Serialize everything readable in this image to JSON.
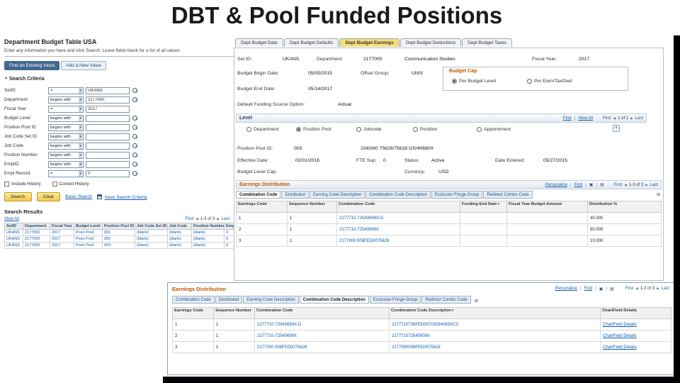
{
  "slide": {
    "title": "DBT & Pool Funded Positions"
  },
  "icons": {
    "dropdown": "▾",
    "collapse": "▼",
    "prev": "◀",
    "next": "▶",
    "sort_desc": "▼",
    "popup": "▣",
    "grid": "▤",
    "show_all": "⊞",
    "plus": "+",
    "sep": "|"
  },
  "colors": {
    "link_blue": "#0b5cab",
    "section_orange": "#c05600",
    "active_tab_yellow": "#f5dd7e",
    "tab_navy": "#44688f"
  },
  "search": {
    "page_title": "Department Budget Table USA",
    "instructions": "Enter any information you have and click Search. Leave fields blank for a list of all values.",
    "tabs": {
      "find": "Find an Existing Value",
      "add": "Add a New Value"
    },
    "criteria_title": "Search Criteria",
    "fields": [
      {
        "label": "SetID",
        "op": "=",
        "value": "UKANS"
      },
      {
        "label": "Department",
        "op": "begins with",
        "value": "2177000"
      },
      {
        "label": "Fiscal Year",
        "op": "=",
        "value": "2017"
      },
      {
        "label": "Budget Level",
        "op": "begins with",
        "value": ""
      },
      {
        "label": "Position Pool ID",
        "op": "begins with",
        "value": ""
      },
      {
        "label": "Job Code Set ID",
        "op": "begins with",
        "value": ""
      },
      {
        "label": "Job Code",
        "op": "begins with",
        "value": ""
      },
      {
        "label": "Position Number",
        "op": "begins with",
        "value": ""
      },
      {
        "label": "EmplID",
        "op": "begins with",
        "value": ""
      },
      {
        "label": "Empl Record",
        "op": "=",
        "value": "0"
      }
    ],
    "include_history": "Include History",
    "correct_history": "Correct History",
    "buttons": {
      "search": "Search",
      "clear": "Clear",
      "basic_search": "Basic Search",
      "save_criteria": "Save Search Criteria"
    },
    "results": {
      "title": "Search Results",
      "view_all": "View All",
      "pager": {
        "first": "First",
        "range": "1-3 of 3",
        "last": "Last"
      },
      "columns": [
        "SetID",
        "Department",
        "Fiscal Year",
        "Budget Level",
        "Position Pool ID",
        "Job Code Set ID",
        "Job Code",
        "Position Number",
        "Empl ID"
      ],
      "rows": [
        [
          "UKANS",
          "2177000",
          "2017",
          "Posn Pool",
          "001",
          "(blank)",
          "(blank)",
          "(blank)",
          "0"
        ],
        [
          "UKANS",
          "2177000",
          "2017",
          "Posn Pool",
          "002",
          "(blank)",
          "(blank)",
          "(blank)",
          "0"
        ],
        [
          "UKANS",
          "2177000",
          "2017",
          "Posn Pool",
          "003",
          "(blank)",
          "(blank)",
          "(blank)",
          "0"
        ]
      ]
    }
  },
  "budget": {
    "tabs": [
      "Dept Budget Data",
      "Dept Budget Defaults",
      "Dept Budget Earnings",
      "Dept Budget Deductions",
      "Dept Budget Taxes"
    ],
    "header": {
      "setid_label": "Set ID:",
      "setid": "UKANS",
      "dept_label": "Department:",
      "dept": "2177000",
      "dept_desc": "Communication Studies",
      "fy_label": "Fiscal Year:",
      "fy": "2017",
      "begin_label": "Budget Begin Date:",
      "begin": "05/05/2015",
      "offset_label": "Offset Group:",
      "offset": "UNIV",
      "end_label": "Budget End Date:",
      "end": "05/14/2017",
      "funding_label": "Default Funding Source Option:",
      "funding": "Actual"
    },
    "budget_cap": {
      "title": "Budget Cap",
      "opt_level": "Per Budget Level",
      "opt_earn": "Per Earn/Tax/Ded"
    },
    "level": {
      "title": "Level",
      "find": "Find",
      "view_all": "View All",
      "pager": {
        "first": "First",
        "range": "1 of 1",
        "last": "Last"
      },
      "options": [
        "Department",
        "Position Pool",
        "Jobcode",
        "Position",
        "Appointment"
      ],
      "pool_label": "Position Pool ID:",
      "pool_value": "003",
      "pool_desc": "1040/60 75628/75628 GS/40680X",
      "eff_label": "Effective Date:",
      "eff_date": "02/01/2016",
      "fte_label": "FTE Sup:",
      "fte": "0",
      "status_label": "Status:",
      "status": "Active",
      "entered_label": "Date Entered:",
      "entered": "05/27/2015",
      "cap_label": "Budget Level Cap:",
      "currency_label": "Currency:",
      "currency": "USD"
    },
    "earnings": {
      "title": "Earnings Distribution",
      "personalize": "Personalize",
      "find": "Find",
      "pager": {
        "first": "First",
        "range": "1-3 of 3",
        "last": "Last"
      },
      "tabs": [
        "Combination Code",
        "Distributed",
        "Earning Code Description",
        "Combination Code Description",
        "Exclusion Fringe Group",
        "Redirect Combo Code"
      ],
      "columns": [
        "Earnings Code",
        "Sequence Number",
        "Combination Code",
        "Funding End Date",
        "Fiscal Year Budget Amount",
        "Distribution %"
      ],
      "rows": [
        [
          "1",
          "1",
          "2177710-72540699X-D",
          "",
          "",
          "40.000"
        ],
        [
          "2",
          "1",
          "2177710-72540699X",
          "",
          "",
          "50.000"
        ],
        [
          "3",
          "1",
          "2177000 008FED0075628",
          "",
          "",
          "10.000"
        ]
      ]
    }
  },
  "earnings_detail": {
    "title": "Earnings Distribution",
    "personalize": "Personalize",
    "find": "Find",
    "pager": {
      "first": "First",
      "range": "1-3 of 3",
      "last": "Last"
    },
    "tabs": [
      "Combination Code",
      "Distributed",
      "Earning Code Description",
      "Combination Code Description",
      "Exclusion Fringe Group",
      "Redirect Combo Code"
    ],
    "columns": [
      "Earnings Code",
      "Sequence Number",
      "Combination Code",
      "Combination Code Description",
      "ChartField Details"
    ],
    "rows": [
      [
        "1",
        "1",
        "2177710-72540699X-D",
        "2177710726FED00703284069XCS",
        "ChartField Details"
      ],
      [
        "2",
        "1",
        "2177710-72540699X",
        "217771072545509X",
        "ChartField Details"
      ],
      [
        "3",
        "1",
        "2177000 008FED0075628",
        "2177000008FED0075628",
        "ChartField Details"
      ]
    ]
  }
}
